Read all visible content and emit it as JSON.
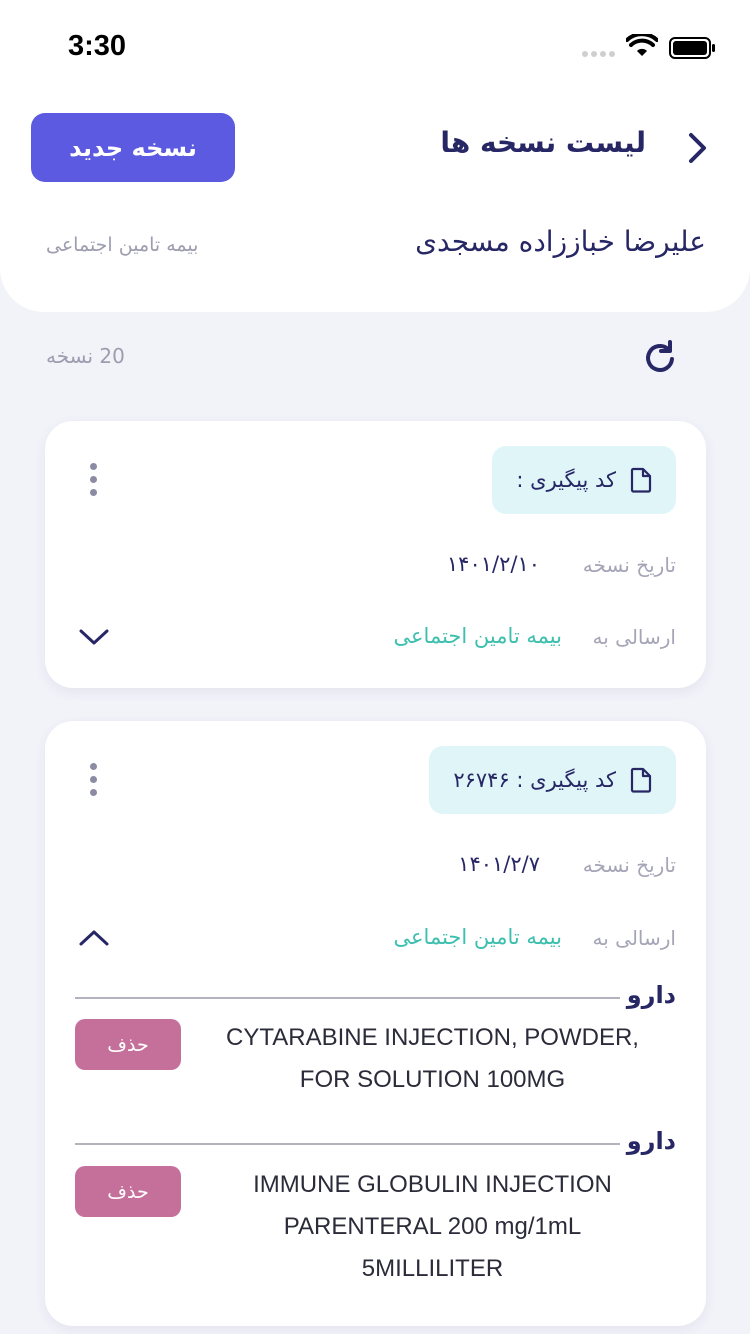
{
  "status_bar": {
    "time": "3:30"
  },
  "header": {
    "title": "لیست نسخه ها",
    "new_button_label": "نسخه جدید",
    "patient_name": "علیرضا خباززاده مسجدی",
    "insurance": "بیمه تامین اجتماعی"
  },
  "list": {
    "count_label": "20 نسخه"
  },
  "prescriptions": [
    {
      "tracking_label": "کد پیگیری :",
      "date_label": "تاریخ نسخه",
      "date_value": "۱۴۰۱/۲/۱۰",
      "send_label": "ارسالی به",
      "send_value": "بیمه تامین اجتماعی",
      "expanded": false
    },
    {
      "tracking_label": "کد پیگیری : ۲۶۷۴۶",
      "date_label": "تاریخ نسخه",
      "date_value": "۱۴۰۱/۲/۷",
      "send_label": "ارسالی به",
      "send_value": "بیمه تامین اجتماعی",
      "expanded": true,
      "drugs": [
        {
          "section_label": "دارو",
          "name": "CYTARABINE INJECTION, POWDER,\nFOR SOLUTION  100MG",
          "delete_label": "حذف"
        },
        {
          "section_label": "دارو",
          "name": "IMMUNE GLOBULIN INJECTION\nPARENTERAL 200 mg/1mL\n5MILLILITER",
          "delete_label": "حذف"
        }
      ]
    }
  ],
  "colors": {
    "primary": "#5b5ae1",
    "title": "#272766",
    "teal": "#3cbfae",
    "tracking_bg": "#dff5f8",
    "delete": "#c5709a",
    "background": "#f2f2f9"
  },
  "icons": [
    "chevron-right-icon",
    "refresh-icon",
    "document-icon",
    "kebab-menu-icon",
    "chevron-down-icon",
    "chevron-up-icon"
  ]
}
